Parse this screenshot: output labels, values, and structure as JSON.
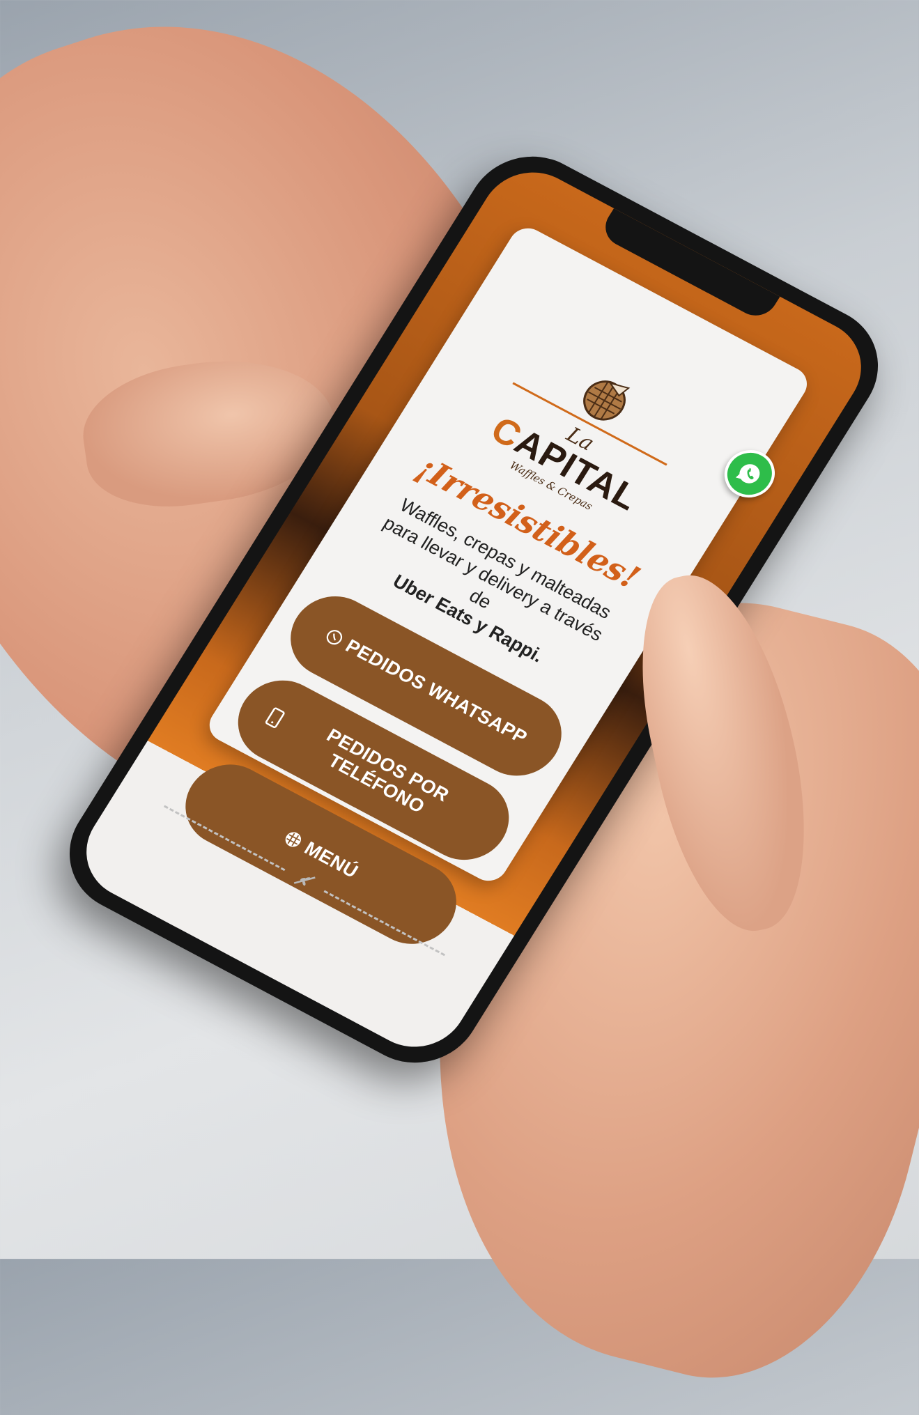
{
  "logo": {
    "la": "La",
    "capital_first": "C",
    "capital_rest": "APITAL",
    "sub": "Waffles & Crepas"
  },
  "tagline": "¡Irresistibles!",
  "description": {
    "text": "Waffles, crepas y malteadas para llevar y delivery a través de",
    "strong": "Uber Eats y Rappi."
  },
  "buttons": {
    "whatsapp": "PEDIDOS WHATSAPP",
    "phone": "PEDIDOS POR TELÉFONO",
    "menu": "MENÚ"
  },
  "colors": {
    "accent_orange": "#d2601a",
    "button_brown": "#8a5526",
    "whatsapp_green": "#2ebd4a"
  },
  "icons": {
    "whatsapp_float": "whatsapp-icon",
    "whatsapp_button": "whatsapp-icon",
    "phone_button": "mobile-phone-icon",
    "menu_button": "waffle-icon",
    "footer": "leaf-icon"
  }
}
